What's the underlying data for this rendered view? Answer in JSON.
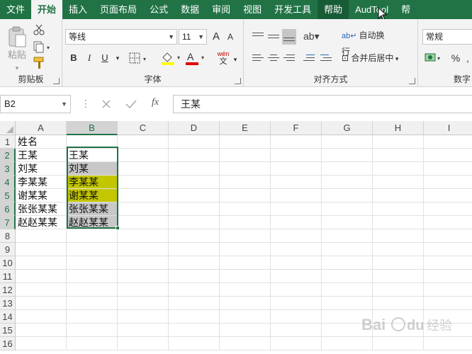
{
  "ribbon_tabs": [
    {
      "label": "文件",
      "state": "normal"
    },
    {
      "label": "开始",
      "state": "active"
    },
    {
      "label": "插入",
      "state": "normal"
    },
    {
      "label": "页面布局",
      "state": "normal"
    },
    {
      "label": "公式",
      "state": "normal"
    },
    {
      "label": "数据",
      "state": "normal"
    },
    {
      "label": "审阅",
      "state": "normal"
    },
    {
      "label": "视图",
      "state": "normal"
    },
    {
      "label": "开发工具",
      "state": "normal"
    },
    {
      "label": "帮助",
      "state": "hover"
    },
    {
      "label": "AudTool",
      "state": "normal"
    },
    {
      "label": "帮",
      "state": "normal"
    }
  ],
  "clipboard": {
    "paste_label": "粘贴",
    "group_label": "剪贴板"
  },
  "font": {
    "name": "等线",
    "size": "11",
    "grow_label": "A",
    "shrink_label": "A",
    "bold": "B",
    "italic": "I",
    "underline": "U",
    "fill_color": "#ffff00",
    "font_color": "#e00000",
    "group_label": "字体",
    "phonetic_top": "wén",
    "phonetic_bottom": "文"
  },
  "alignment": {
    "wrap_text": "自动换行",
    "merge_center": "合并后居中",
    "group_label": "对齐方式"
  },
  "number": {
    "format": "常规",
    "percent": "%",
    "group_label": "数字"
  },
  "formula_bar": {
    "cell_ref": "B2",
    "content": "王某",
    "fx": "fx"
  },
  "columns": [
    "A",
    "B",
    "C",
    "D",
    "E",
    "F",
    "G",
    "H",
    "I"
  ],
  "selected_column": "B",
  "rows": [
    "1",
    "2",
    "3",
    "4",
    "5",
    "6",
    "7",
    "8",
    "9",
    "10",
    "11",
    "12",
    "13",
    "14",
    "15",
    "16"
  ],
  "column_a": [
    "姓名",
    "王某",
    "刘某",
    "李某某",
    "谢某某",
    "张张某某",
    "赵赵某某"
  ],
  "column_b": [
    {
      "row": "2",
      "text": "王某",
      "fill": ""
    },
    {
      "row": "3",
      "text": "刘某",
      "fill": "#c8c8c8"
    },
    {
      "row": "4",
      "text": "李某某",
      "fill": "#c3c600"
    },
    {
      "row": "5",
      "text": "谢某某",
      "fill": "#c3c600"
    },
    {
      "row": "6",
      "text": "张张某某",
      "fill": "#c8c8c8"
    },
    {
      "row": "7",
      "text": "赵赵某某",
      "fill": "#c8c8c8"
    }
  ],
  "watermark": {
    "text": "Bai du 经验"
  },
  "colors": {
    "accent": "#217346"
  }
}
